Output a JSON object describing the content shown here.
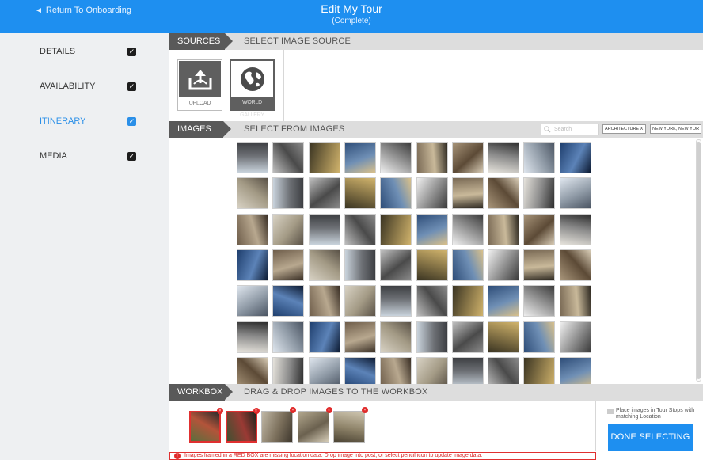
{
  "header": {
    "back_label": "Return To Onboarding",
    "title": "Edit My Tour",
    "subtitle": "(Complete)"
  },
  "sidebar": {
    "items": [
      {
        "label": "DETAILS",
        "checked": true
      },
      {
        "label": "AVAILABILITY",
        "checked": true
      },
      {
        "label": "ITINERARY",
        "checked": true,
        "active": true
      },
      {
        "label": "MEDIA",
        "checked": true
      }
    ]
  },
  "sources": {
    "tab": "SOURCES",
    "desc": "SELECT IMAGE SOURCE",
    "upload_label": "UPLOAD",
    "gallery_label": "WORLD GALLERY"
  },
  "images": {
    "tab": "IMAGES",
    "desc": "SELECT FROM IMAGES",
    "search_placeholder": "Search",
    "filters": [
      "ARCHITECTURE X",
      "NEW YORK, NEW YOR"
    ]
  },
  "workbox": {
    "tab": "WORKBOX",
    "desc": "DRAG & DROP IMAGES TO THE WORKBOX",
    "notice": "Images framed in a RED BOX are missing location data. Drop image into post, or select pencil icon to update image data.",
    "option_label": "Place images in Tour Stops with matching Location",
    "done_label": "DONE SELECTING"
  },
  "colors": {
    "accent": "#1e8ff0",
    "warning": "#e03030"
  }
}
